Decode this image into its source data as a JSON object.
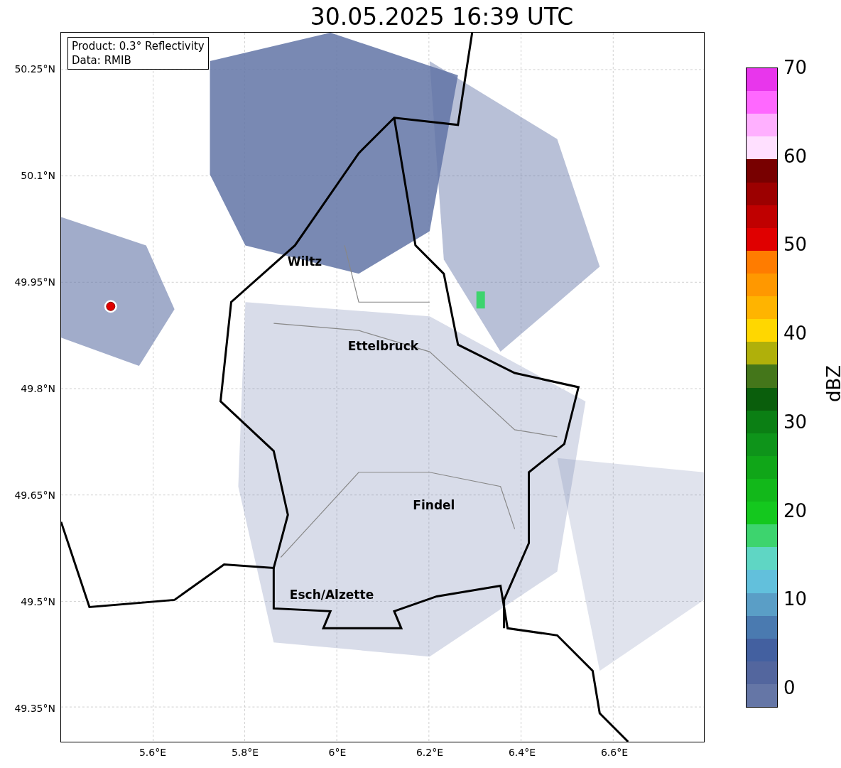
{
  "title": "30.05.2025 16:39 UTC",
  "info_box": [
    "Product: 0.3° Reflectivity",
    "Data: RMIB"
  ],
  "y_ticks": [
    "50.25°N",
    "50.1°N",
    "49.95°N",
    "49.8°N",
    "49.65°N",
    "49.5°N",
    "49.35°N"
  ],
  "x_ticks": [
    "5.6°E",
    "5.8°E",
    "6°E",
    "6.2°E",
    "6.4°E",
    "6.6°E"
  ],
  "cities": [
    {
      "name": "Wiltz"
    },
    {
      "name": "Ettelbruck"
    },
    {
      "name": "Findel"
    },
    {
      "name": "Esch/Alzette"
    }
  ],
  "colorbar": {
    "label": "dBZ",
    "ticks": [
      "70",
      "60",
      "50",
      "40",
      "30",
      "20",
      "10",
      "0"
    ],
    "segments": [
      {
        "color": "#6576a6"
      },
      {
        "color": "#53669e"
      },
      {
        "color": "#4360a0"
      },
      {
        "color": "#4a7ab0"
      },
      {
        "color": "#5a9ec6"
      },
      {
        "color": "#62c0dc"
      },
      {
        "color": "#5fd6c4"
      },
      {
        "color": "#3dd46e"
      },
      {
        "color": "#14c81e"
      },
      {
        "color": "#12b81a"
      },
      {
        "color": "#10a618"
      },
      {
        "color": "#0e941a"
      },
      {
        "color": "#0b7f14"
      },
      {
        "color": "#0a5e0c"
      },
      {
        "color": "#44761a"
      },
      {
        "color": "#b0b00a"
      },
      {
        "color": "#ffd700"
      },
      {
        "color": "#ffb400"
      },
      {
        "color": "#ff9800"
      },
      {
        "color": "#ff7c00"
      },
      {
        "color": "#e00000"
      },
      {
        "color": "#c00000"
      },
      {
        "color": "#9c0000"
      },
      {
        "color": "#780000"
      },
      {
        "color": "#ffe0ff"
      },
      {
        "color": "#ffb0ff"
      },
      {
        "color": "#ff68ff"
      },
      {
        "color": "#e836ec"
      }
    ]
  }
}
